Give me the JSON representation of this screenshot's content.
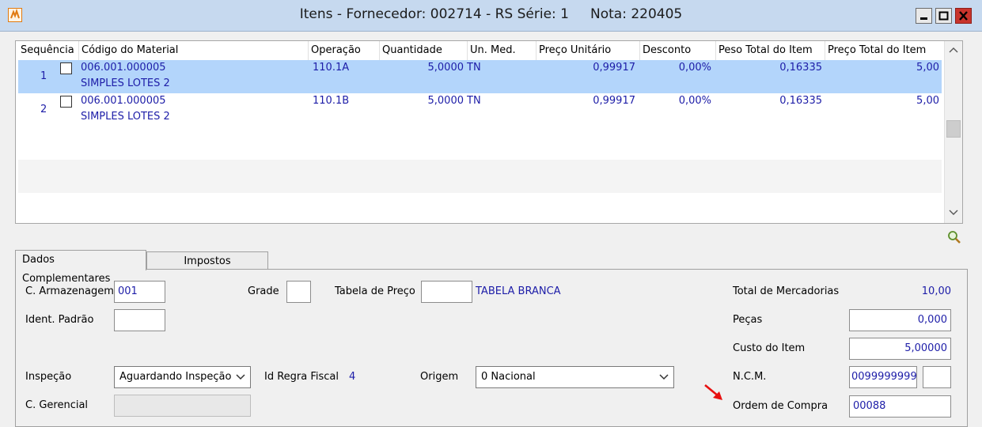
{
  "window": {
    "title": "Itens - Fornecedor: 002714 - RS Série: 1     Nota: 220405"
  },
  "grid": {
    "columns": [
      "Sequência",
      "Código do Material",
      "Operação",
      "Quantidade",
      "Un. Med.",
      "Preço Unitário",
      "Desconto",
      "Peso Total do Item",
      "Preço Total do Item"
    ],
    "rows": [
      {
        "seq": "1",
        "code": "006.001.000005",
        "desc": "SIMPLES LOTES 2",
        "op": "110.1A",
        "qty": "5,0000",
        "unit": "TN",
        "price": "0,99917",
        "discount": "0,00%",
        "weight": "0,16335",
        "total": "5,00"
      },
      {
        "seq": "2",
        "code": "006.001.000005",
        "desc": "SIMPLES LOTES 2",
        "op": "110.1B",
        "qty": "5,0000",
        "unit": "TN",
        "price": "0,99917",
        "discount": "0,00%",
        "weight": "0,16335",
        "total": "5,00"
      }
    ]
  },
  "tabs": [
    "Dados Complementares",
    "Impostos"
  ],
  "form": {
    "armazenagem": {
      "label": "C. Armazenagem",
      "value": "001"
    },
    "grade": {
      "label": "Grade",
      "value": ""
    },
    "tabela_preco": {
      "label": "Tabela de Preço",
      "value": "",
      "name": "TABELA BRANCA"
    },
    "ident_padrao": {
      "label": "Ident. Padrão",
      "value": ""
    },
    "inspecao": {
      "label": "Inspeção",
      "value": "Aguardando Inspeção"
    },
    "regra_fiscal": {
      "label": "Id Regra Fiscal",
      "value": "4"
    },
    "origem": {
      "label": "Origem",
      "value": "0 Nacional"
    },
    "gerencial": {
      "label": "C. Gerencial",
      "value": ""
    }
  },
  "totals": {
    "mercadorias": {
      "label": "Total de Mercadorias",
      "value": "10,00"
    },
    "pecas": {
      "label": "Peças",
      "value": "0,000"
    },
    "custo": {
      "label": "Custo do Item",
      "value": "5,00000"
    },
    "ncm": {
      "label": "N.C.M.",
      "value": "0099999999",
      "ext": ""
    },
    "ordem": {
      "label": "Ordem de Compra",
      "value": "00088"
    }
  },
  "colors": {
    "selected_row": "#b3d5fb",
    "link_text": "#1d1da8",
    "annotation_arrow": "#e81010"
  }
}
